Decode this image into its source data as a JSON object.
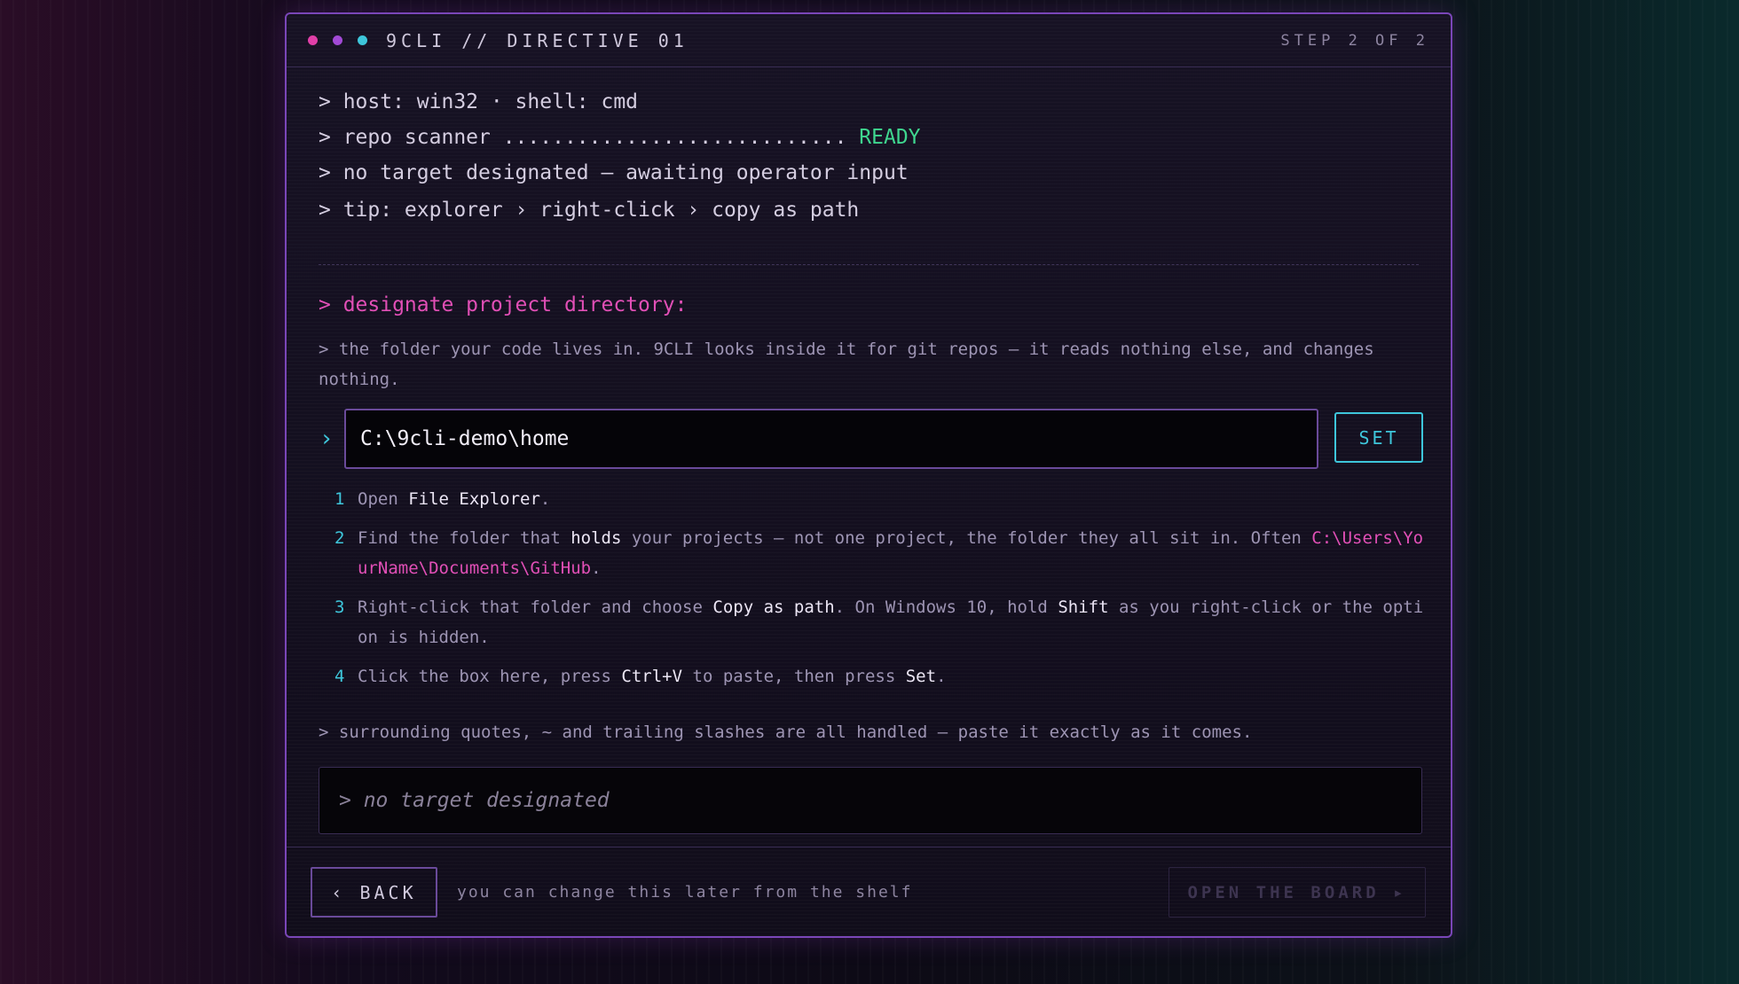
{
  "window": {
    "dot_colors": [
      "#e13fa8",
      "#a24ad6",
      "#3ec6db"
    ],
    "title": "9CLI // DIRECTIVE 01",
    "step_label": "STEP 2 OF 2"
  },
  "log": {
    "line1": "> host: win32 · shell: cmd",
    "line2_prefix": "> repo scanner ............................ ",
    "line2_status": "READY",
    "line3": "> no target designated — awaiting operator input",
    "line4": "> tip: explorer › right-click › copy as path"
  },
  "prompt": {
    "heading": "> designate project directory:",
    "description": "> the folder your code lives in. 9CLI looks inside it for git repos — it reads nothing else, and changes nothing.",
    "chevron": "›",
    "input_value": "C:\\9cli-demo\\home",
    "set_label": "SET"
  },
  "steps": [
    {
      "num": "1",
      "parts": [
        "Open ",
        "File Explorer",
        "."
      ]
    },
    {
      "num": "2",
      "parts": [
        "Find the folder that ",
        "holds",
        " your projects — not one project, the folder they all sit in. Often ",
        "C:\\Users\\YourName\\Documents\\GitHub",
        "."
      ]
    },
    {
      "num": "3",
      "parts": [
        "Right-click that folder and choose ",
        "Copy as path",
        ". On Windows 10, hold ",
        "Shift",
        " as you right-click or the option is hidden."
      ]
    },
    {
      "num": "4",
      "parts": [
        "Click the box here, press ",
        "Ctrl+V",
        " to paste, then press ",
        "Set",
        "."
      ]
    }
  ],
  "note": "> surrounding quotes, ~ and trailing slashes are all handled — paste it exactly as it comes.",
  "status": "> no target designated",
  "footer": {
    "back_label": "‹ BACK",
    "hint": "you can change this later from the shelf",
    "open_label": "OPEN THE BOARD ▸"
  }
}
